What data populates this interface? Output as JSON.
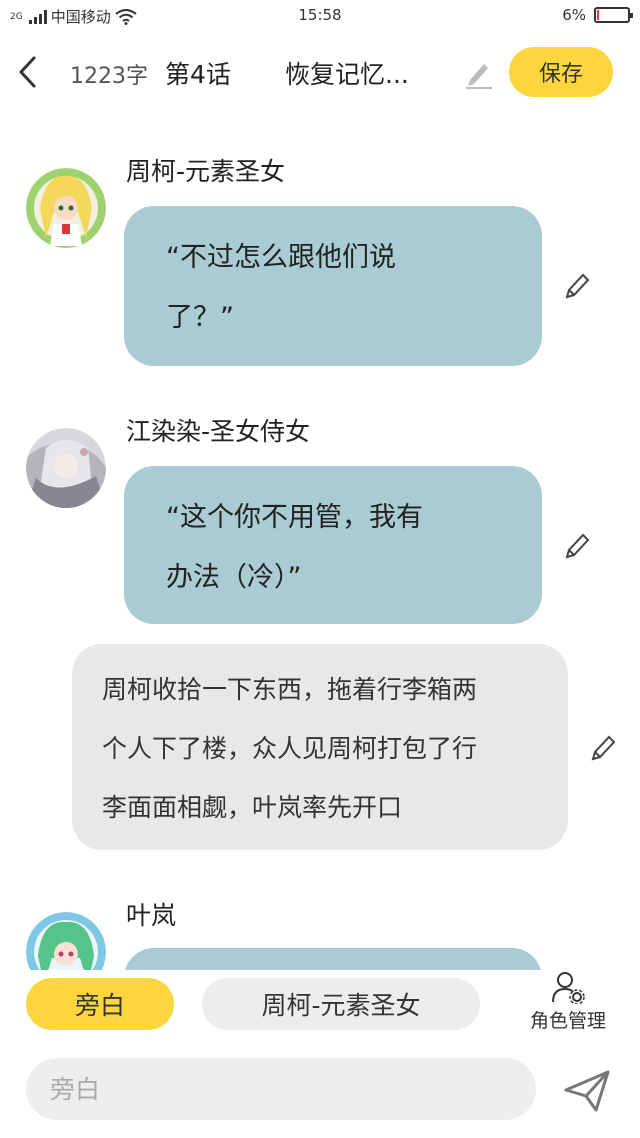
{
  "status_bar": {
    "network": "2G",
    "carrier": "中国移动",
    "time": "15:58",
    "battery": "6%",
    "battery_level": 0.06
  },
  "header": {
    "word_count": "1223字",
    "chapter": "第4话",
    "title": "恢复记忆...",
    "save_label": "保存"
  },
  "messages": [
    {
      "type": "dialogue",
      "name": "周柯-元素圣女",
      "lines": [
        "“不过怎么跟他们说",
        "了？”"
      ]
    },
    {
      "type": "dialogue",
      "name": "江染染-圣女侍女",
      "lines": [
        "“这个你不用管，我有",
        "办法（冷）”"
      ]
    },
    {
      "type": "narration",
      "lines": [
        "周柯收拾一下东西，拖着行李箱两",
        "个人下了楼，众人见周柯打包了行",
        "李面面相觑，叶岚率先开口"
      ]
    },
    {
      "type": "dialogue",
      "name": "叶岚",
      "lines": [
        ""
      ]
    }
  ],
  "bottom": {
    "narration_pill": "旁白",
    "character_pill": "周柯-元素圣女",
    "role_management": "角色管理",
    "input_placeholder": "旁白"
  },
  "colors": {
    "accent": "#fcd63c",
    "dialogue_bubble": "#a9cbd3",
    "narration_bubble": "#e8e8e8"
  }
}
